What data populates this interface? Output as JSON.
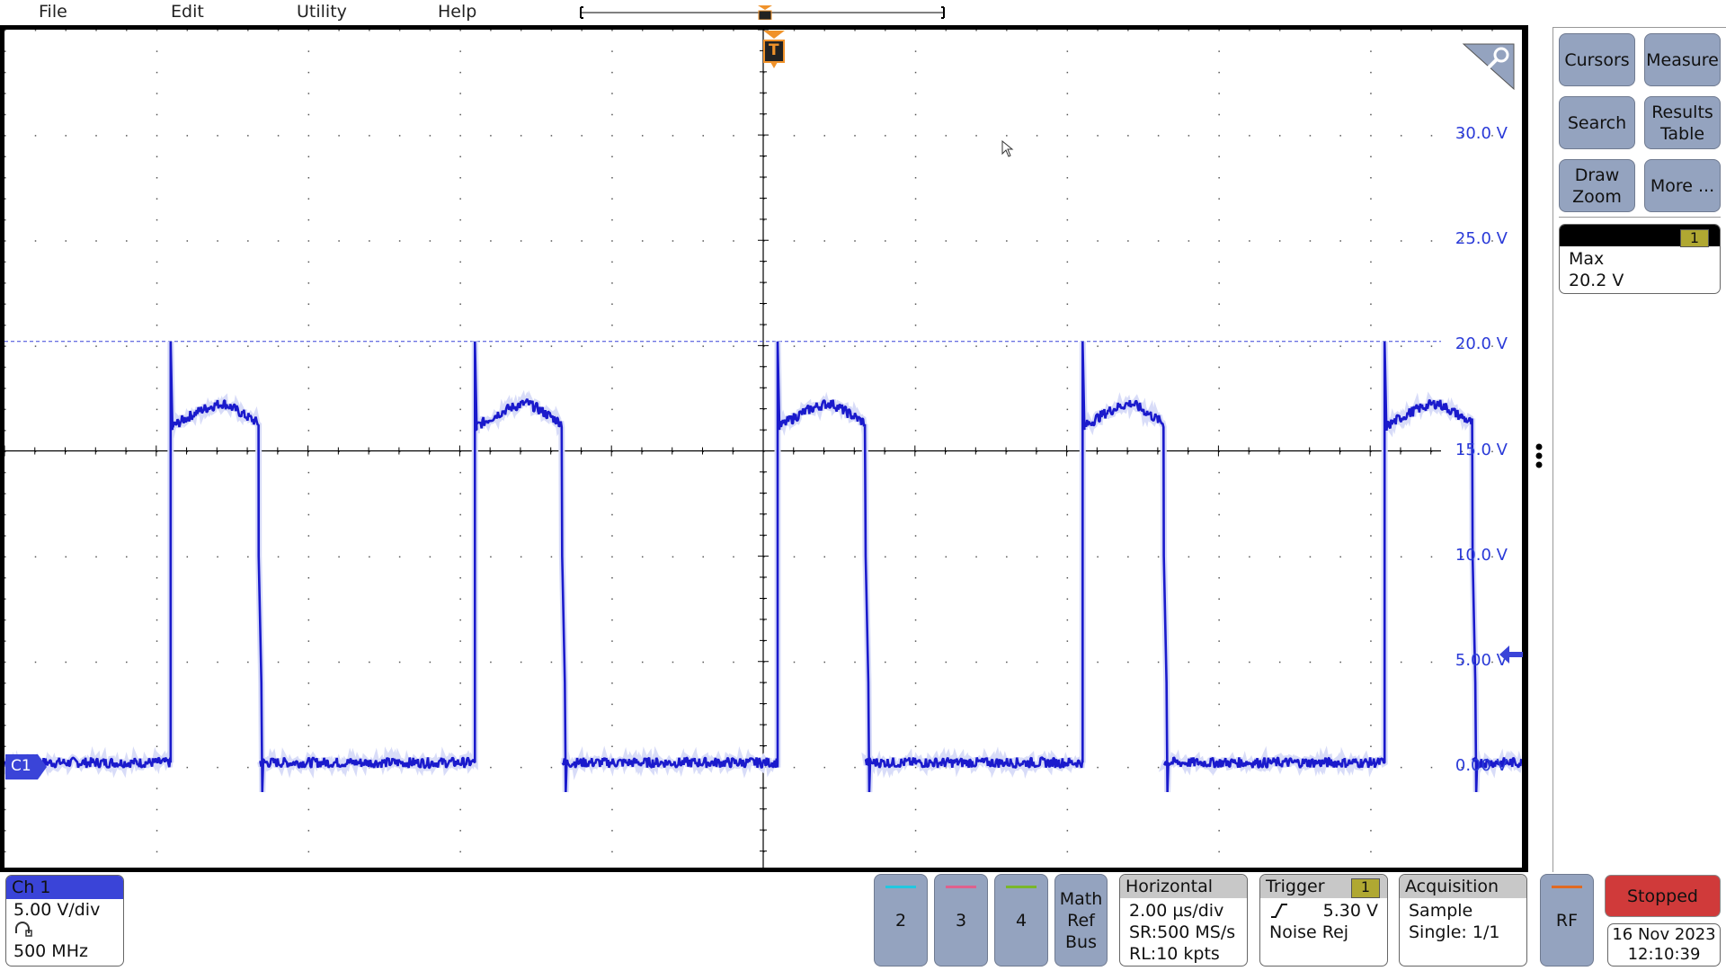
{
  "menu": {
    "items": [
      "File",
      "Edit",
      "Utility",
      "Help"
    ]
  },
  "colors": {
    "trace": "#1a1acc",
    "accent_orange": "#f0922a",
    "ch2": "#22c8e0",
    "ch3": "#e0608c",
    "ch4": "#7ab82a",
    "rf": "#e06a22",
    "stopped": "#d03a3a",
    "ch1": "#3a44d8"
  },
  "right_panel": {
    "buttons": [
      "Cursors",
      "Measure",
      "Search",
      "Results Table",
      "Draw Zoom",
      "More ..."
    ],
    "measurement": {
      "source": "1",
      "label": "Max",
      "value": "20.2 V"
    }
  },
  "channel1": {
    "title": "Ch 1",
    "scale": "5.00 V/div",
    "probe_icon": "probe-icon",
    "bandwidth": "500 MHz",
    "marker": "C1"
  },
  "channel_buttons": [
    "2",
    "3",
    "4"
  ],
  "math_ref_bus": [
    "Math",
    "Ref",
    "Bus"
  ],
  "horizontal": {
    "title": "Horizontal",
    "scale": "2.00 µs/div",
    "sample_rate": "SR:500 MS/s",
    "record_length": "RL:10 kpts"
  },
  "trigger": {
    "title": "Trigger",
    "source": "1",
    "level": "5.30 V",
    "mode": "Noise Rej",
    "slope_icon": "rising-edge-icon"
  },
  "acquisition": {
    "title": "Acquisition",
    "mode": "Sample",
    "state": "Single: 1/1"
  },
  "rf": "RF",
  "run_state": "Stopped",
  "datetime": {
    "date": "16 Nov 2023",
    "time": "12:10:39"
  },
  "trigger_marker": "T",
  "chart_data": {
    "type": "line",
    "xlabel": "",
    "ylabel": "",
    "xlim_us": [
      -10,
      10
    ],
    "ylim_V": [
      -5,
      35
    ],
    "y_tick_labels": [
      "30.0 V",
      "25.0 V",
      "20.0 V",
      "15.0 V",
      "10.0 V",
      "5.00 V",
      "0.00 V"
    ],
    "y_ticks": [
      30,
      25,
      20,
      15,
      10,
      5,
      0
    ],
    "grid": true,
    "divisions": {
      "x": 10,
      "y": 8
    },
    "series": [
      {
        "low_V": 0.2,
        "plateau_V": 17.3,
        "spike_V": 20.2,
        "undershoot_V": -1.2,
        "rising_edges_us": [
          -7.81,
          -3.8,
          0.19,
          4.21,
          8.19
        ],
        "falling_edges_us": [
          -6.65,
          -2.65,
          1.35,
          5.28,
          9.35
        ]
      }
    ],
    "max_line_V": 20.2,
    "trigger_level_V": 5.3
  }
}
